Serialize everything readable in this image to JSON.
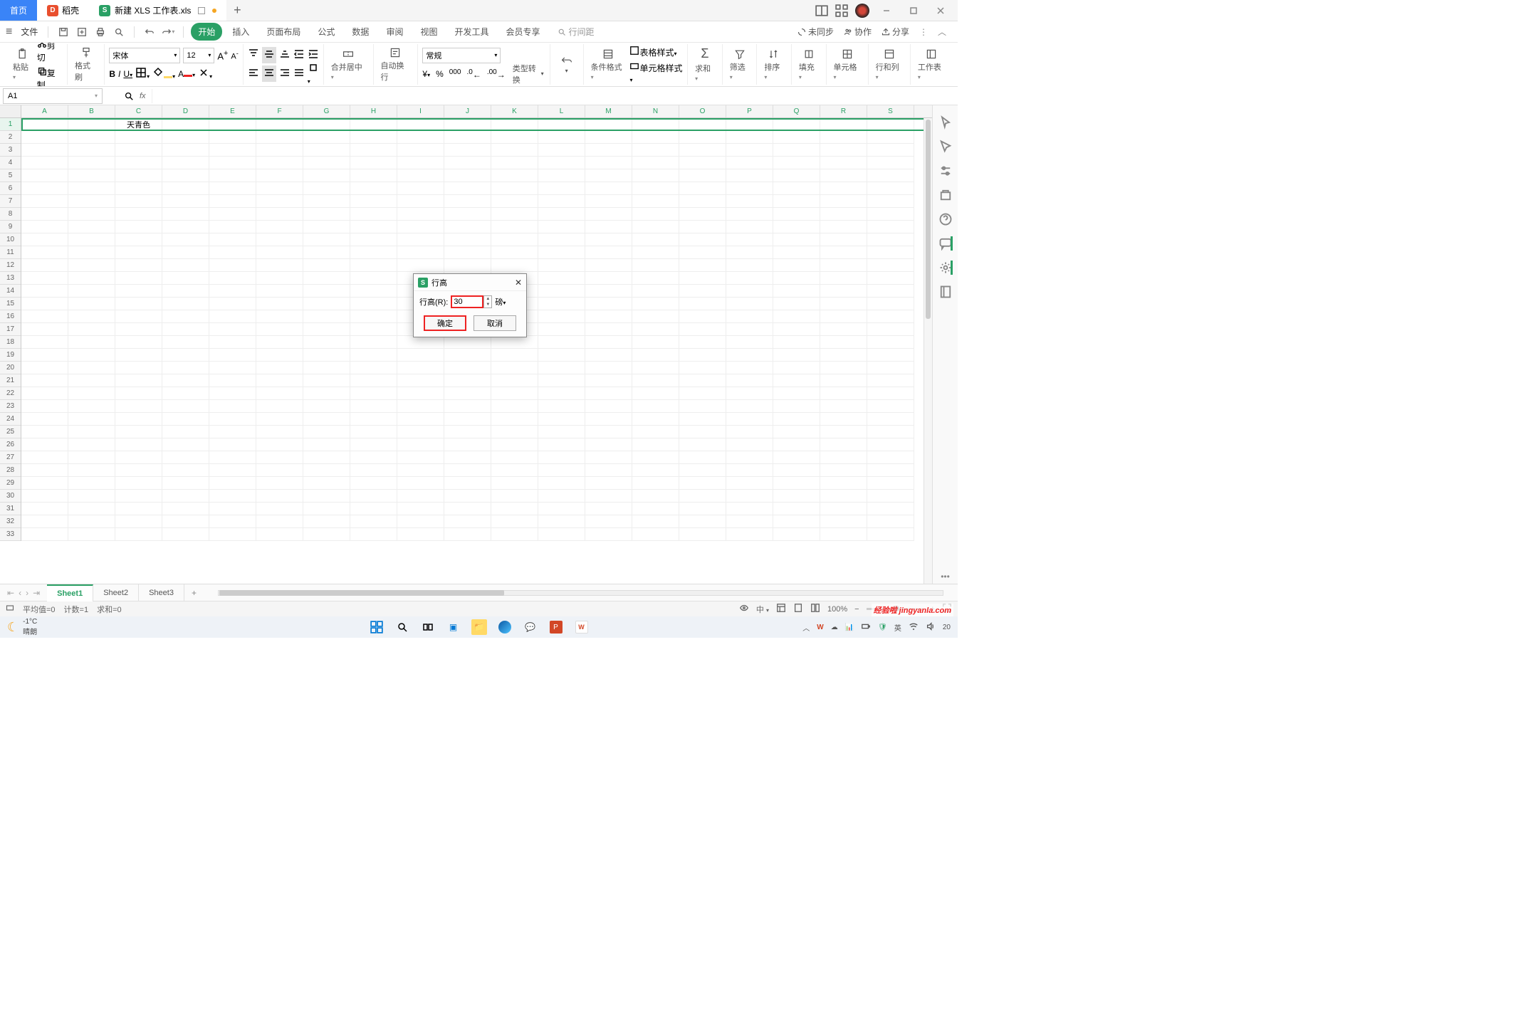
{
  "titlebar": {
    "home_tab": "首页",
    "doke_tab": "稻壳",
    "doc_tab": "新建 XLS 工作表.xls"
  },
  "menubar": {
    "file": "文件",
    "tabs": [
      "开始",
      "插入",
      "页面布局",
      "公式",
      "数据",
      "审阅",
      "视图",
      "开发工具",
      "会员专享"
    ],
    "search_placeholder": "行间距",
    "unsync": "未同步",
    "collab": "协作",
    "share": "分享"
  },
  "ribbon": {
    "paste": "粘贴",
    "cut": "剪切",
    "copy": "复制",
    "format_painter": "格式刷",
    "font": "宋体",
    "font_size": "12",
    "merge_center": "合并居中",
    "auto_wrap": "自动换行",
    "number_fmt": "常规",
    "type_conv": "类型转换",
    "cond_fmt": "条件格式",
    "table_style": "表格样式",
    "cell_style": "单元格样式",
    "sum": "求和",
    "filter": "筛选",
    "sort": "排序",
    "fill": "填充",
    "cells": "单元格",
    "rowcol": "行和列",
    "worksheet": "工作表"
  },
  "namebox": {
    "ref": "A1"
  },
  "grid": {
    "cols": [
      "A",
      "B",
      "C",
      "D",
      "E",
      "F",
      "G",
      "H",
      "I",
      "J",
      "K",
      "L",
      "M",
      "N",
      "O",
      "P",
      "Q",
      "R",
      "S"
    ],
    "rows": [
      "1",
      "2",
      "3",
      "4",
      "5",
      "6",
      "7",
      "8",
      "9",
      "10",
      "11",
      "12",
      "13",
      "14",
      "15",
      "16",
      "17",
      "18",
      "19",
      "20",
      "21",
      "22",
      "23",
      "24",
      "25",
      "26",
      "27",
      "28",
      "29",
      "30",
      "31",
      "32",
      "33"
    ],
    "c1_text": "天青色"
  },
  "sheets": [
    "Sheet1",
    "Sheet2",
    "Sheet3"
  ],
  "status": {
    "avg": "平均值=0",
    "count": "计数=1",
    "sum": "求和=0",
    "zoom": "100%"
  },
  "dialog": {
    "title": "行高",
    "label": "行高(R):",
    "value": "30",
    "unit": "磅",
    "ok": "确定",
    "cancel": "取消"
  },
  "taskbar": {
    "temp": "-1°C",
    "weather": "晴朗",
    "ime": "英",
    "time": "20",
    "date": ""
  },
  "watermark": "经验啦 jingyanla.com"
}
